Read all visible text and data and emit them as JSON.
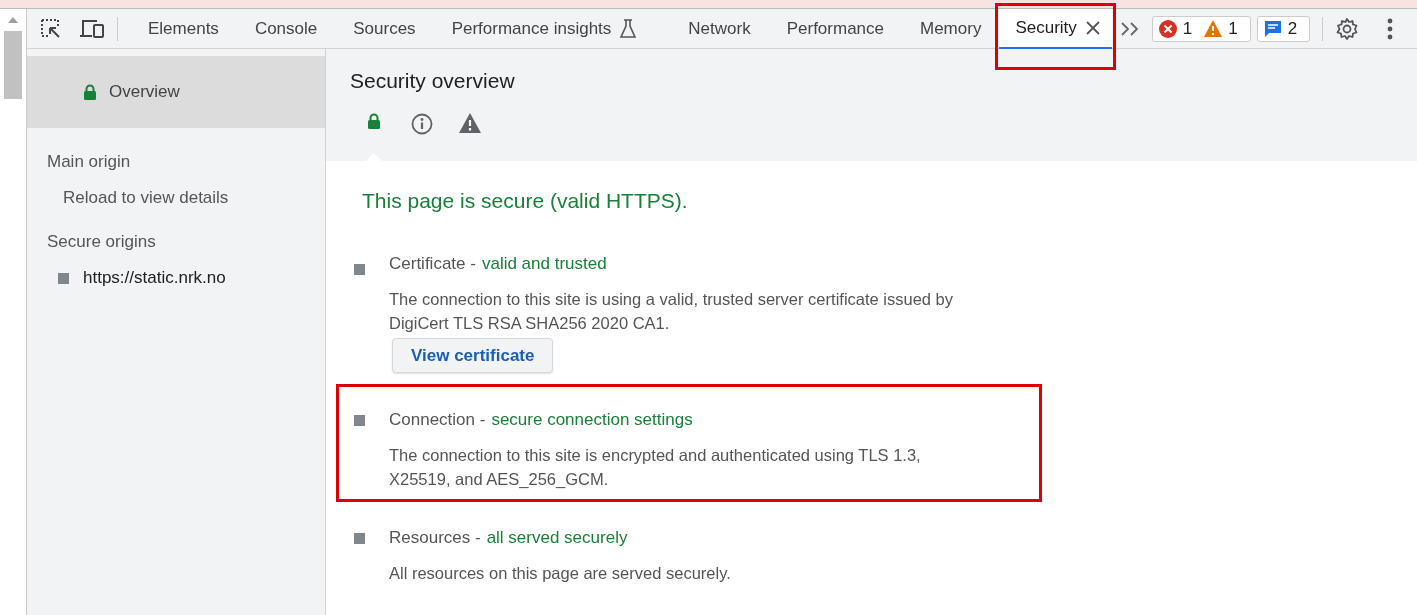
{
  "toolbar": {
    "tabs": [
      {
        "label": "Elements",
        "kind": "plain",
        "selected": false,
        "closable": false,
        "highlighted": false
      },
      {
        "label": "Console",
        "kind": "plain",
        "selected": false,
        "closable": false,
        "highlighted": false
      },
      {
        "label": "Sources",
        "kind": "plain",
        "selected": false,
        "closable": false,
        "highlighted": false
      },
      {
        "label": "Performance insights",
        "kind": "experimental",
        "selected": false,
        "closable": false,
        "highlighted": false
      },
      {
        "label": "Network",
        "kind": "plain",
        "selected": false,
        "closable": false,
        "highlighted": false
      },
      {
        "label": "Performance",
        "kind": "plain",
        "selected": false,
        "closable": false,
        "highlighted": false
      },
      {
        "label": "Memory",
        "kind": "plain",
        "selected": false,
        "closable": false,
        "highlighted": false
      },
      {
        "label": "Security",
        "kind": "plain",
        "selected": true,
        "closable": true,
        "highlighted": true
      }
    ],
    "issue_counts": [
      {
        "kind": "error",
        "count": "1"
      },
      {
        "kind": "warning",
        "count": "1"
      }
    ],
    "message_count": "2"
  },
  "sidebar": {
    "items": [
      {
        "label": "Overview",
        "selected": true
      }
    ],
    "sections": [
      {
        "heading": "Main origin",
        "items": [
          {
            "label": "Reload to view details",
            "kind": "note"
          }
        ]
      },
      {
        "heading": "Secure origins",
        "items": [
          {
            "label": "https://static.nrk.no",
            "kind": "origin"
          }
        ]
      }
    ]
  },
  "main": {
    "title": "Security overview",
    "icon_tabs": [
      {
        "kind": "secure",
        "selected": true
      },
      {
        "kind": "info",
        "selected": false
      },
      {
        "kind": "warning",
        "selected": false
      }
    ],
    "summary": "This page is secure (valid HTTPS).",
    "sections": [
      {
        "title": "Certificate -",
        "status": "valid and trusted",
        "description": "The connection to this site is using a valid, trusted server certificate issued by DigiCert TLS RSA SHA256 2020 CA1.",
        "button": "View certificate",
        "highlighted": false
      },
      {
        "title": "Connection -",
        "status": "secure connection settings",
        "description": "The connection to this site is encrypted and authenticated using TLS 1.3, X25519, and AES_256_GCM.",
        "highlighted": true
      },
      {
        "title": "Resources -",
        "status": "all served securely",
        "description": "All resources on this page are served securely.",
        "highlighted": false
      }
    ]
  }
}
